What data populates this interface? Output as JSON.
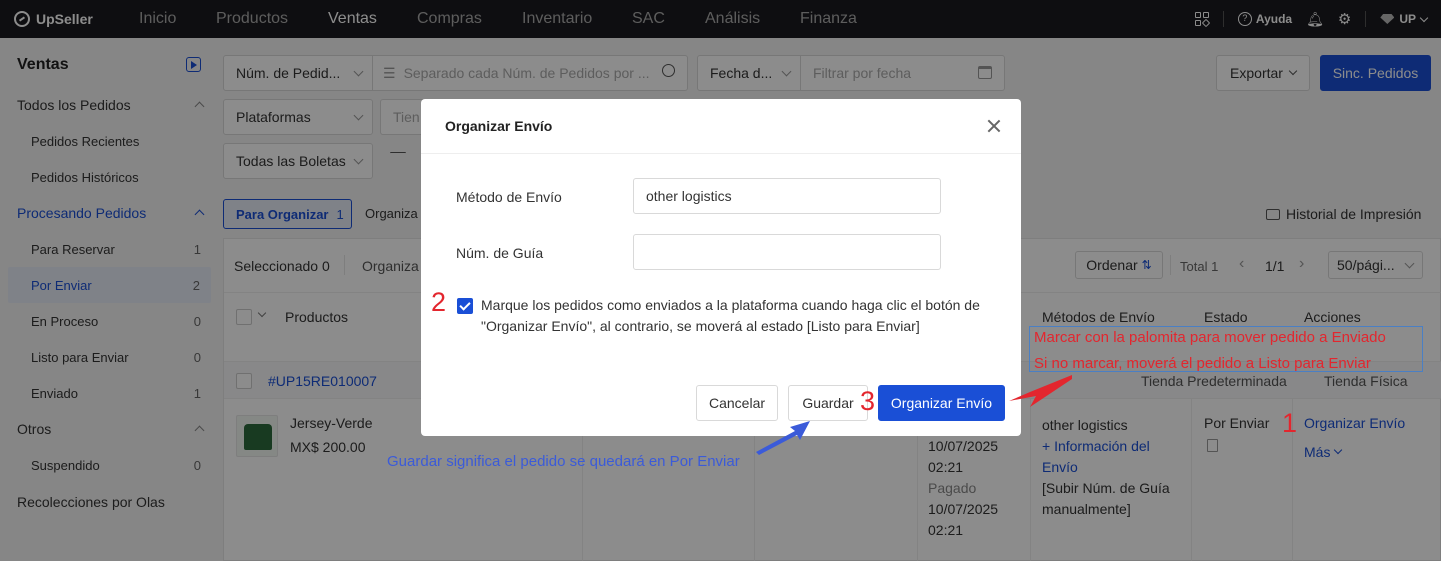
{
  "app": {
    "brand": "UpSeller",
    "nav": [
      "Inicio",
      "Productos",
      "Ventas",
      "Compras",
      "Inventario",
      "SAC",
      "Análisis",
      "Finanza"
    ],
    "active_nav": "Ventas",
    "help": "Ayuda",
    "user": "UP"
  },
  "sidebar": {
    "title": "Ventas",
    "items": [
      {
        "label": "Todos los Pedidos",
        "type": "group"
      },
      {
        "label": "Pedidos Recientes",
        "type": "child"
      },
      {
        "label": "Pedidos Históricos",
        "type": "child"
      },
      {
        "label": "Procesando Pedidos",
        "type": "group-active"
      },
      {
        "label": "Para Reservar",
        "count": "1",
        "type": "child"
      },
      {
        "label": "Por Enviar",
        "count": "2",
        "type": "child-selected"
      },
      {
        "label": "En Proceso",
        "count": "0",
        "type": "child"
      },
      {
        "label": "Listo para Enviar",
        "count": "0",
        "type": "child"
      },
      {
        "label": "Enviado",
        "count": "1",
        "type": "child"
      },
      {
        "label": "Otros",
        "type": "group"
      },
      {
        "label": "Suspendido",
        "count": "0",
        "type": "child"
      },
      {
        "label": "Recolecciones por Olas",
        "type": "plain"
      }
    ]
  },
  "filters": {
    "order_select": "Núm. de Pedid...",
    "order_placeholder": "Separado cada Núm. de Pedidos por ...",
    "date_select": "Fecha d...",
    "date_placeholder": "Filtrar por fecha",
    "platform_select": "Plataformas",
    "store_placeholder": "Tien",
    "tickets_select": "Todas las Boletas",
    "export_label": "Exportar",
    "sync_label": "Sinc. Pedidos"
  },
  "tabs": {
    "to_organize": "Para Organizar",
    "to_organize_count": "1",
    "organized_partial": "Organiza",
    "print_history": "Historial de Impresión"
  },
  "toolbar": {
    "selected": "Seleccionado 0",
    "organize_partial": "Organiza",
    "sort": "Ordenar",
    "total": "Total 1",
    "page": "1/1",
    "per_page": "50/pági..."
  },
  "table": {
    "headers": {
      "products": "Productos",
      "shipping_methods": "Métodos de Envío",
      "status": "Estado",
      "actions": "Acciones"
    },
    "order_id": "#UP15RE010007",
    "store_default": "Tienda Predeterminada",
    "store_physical": "Tienda Física",
    "product_name": "Jersey-Verde",
    "product_price": "MX$ 200.00",
    "date1": "10/07/2025",
    "time1": "02:21",
    "paid_label": "Pagado",
    "date2": "10/07/2025",
    "time2": "02:21",
    "shipping_method": "other logistics",
    "more_info": "+ Información del Envío",
    "upload_guide": "[Subir Núm. de Guía manualmente]",
    "status": "Por Enviar",
    "action_organize": "Organizar Envío",
    "action_more": "Más"
  },
  "modal": {
    "title": "Organizar Envío",
    "shipping_method_label": "Método de Envío",
    "shipping_method_value": "other logistics",
    "guide_label": "Núm. de Guía",
    "guide_value": "",
    "checkbox_text": "Marque los pedidos como enviados a la plataforma cuando haga clic el botón de \"Organizar Envío\", al contrario, se moverá al estado [Listo para Enviar]",
    "cancel": "Cancelar",
    "save": "Guardar",
    "submit": "Organizar Envío"
  },
  "annotations": {
    "note_red_1": "Marcar con la palomita para mover pedido a Enviado",
    "note_red_2": "Si no marcar, moverá el pedido a Listo para Enviar",
    "note_blue": "Guardar significa el pedido se quedará en Por Enviar",
    "num1": "1",
    "num2": "2",
    "num3": "3"
  },
  "colors": {
    "accent": "#1a4fd6",
    "annotation_red": "#e3262e",
    "annotation_blue": "#3b5bd9"
  }
}
